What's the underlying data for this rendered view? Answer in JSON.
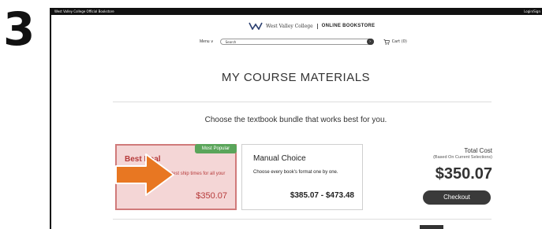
{
  "step_number": "3",
  "topbar": {
    "site_title": "West Valley College Official Bookstore",
    "login_link": "Login/Sign"
  },
  "header": {
    "college_name": "West Valley College",
    "store_name": "ONLINE BOOKSTORE",
    "logo_icon": "wv-logo-icon"
  },
  "nav": {
    "menu_label": "Menu ∨",
    "search_placeholder": "Search",
    "search_button_glyph": "›",
    "cart_label": "Cart (0)",
    "cart_icon": "cart-icon"
  },
  "main": {
    "title": "MY COURSE MATERIALS",
    "subtitle": "Choose the textbook bundle that works best for you."
  },
  "options": {
    "best": {
      "badge": "Most Popular",
      "title": "Best Deal",
      "description": "The best price and fastest ship times for all your materials.",
      "price": "$350.07"
    },
    "manual": {
      "title": "Manual Choice",
      "description": "Choose every book's format one by one.",
      "price": "$385.07 - $473.48"
    }
  },
  "summary": {
    "total_label": "Total Cost",
    "total_sub": "(Based On Current Selections)",
    "total_amount": "$350.07",
    "checkout_label": "Checkout"
  },
  "colors": {
    "accent_red": "#b63a3a",
    "badge_green": "#5aa55a",
    "arrow_orange": "#e87722",
    "dark": "#3a3a3a"
  }
}
